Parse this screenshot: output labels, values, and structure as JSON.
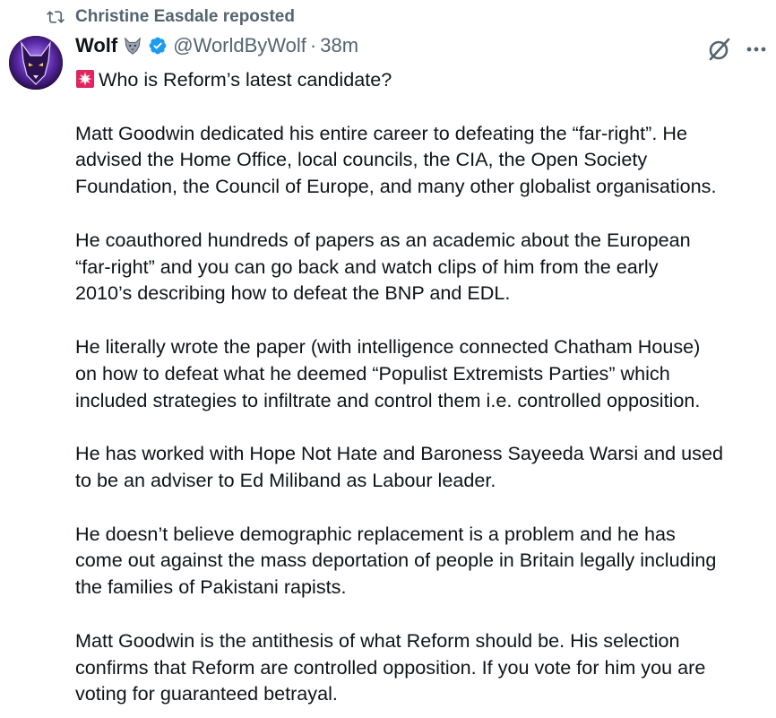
{
  "repost": {
    "icon": "repost-icon",
    "text": "Christine Easdale reposted"
  },
  "author": {
    "name": "Wolf",
    "name_emoji": "wolf-emoji",
    "verified_icon": "verified-badge-icon",
    "handle": "@WorldByWolf",
    "separator": "·",
    "time": "38m",
    "avatar": "wolf-avatar"
  },
  "actions": {
    "grok_icon": "grok-icon",
    "more_icon": "more-icon"
  },
  "tweet": {
    "headline_icon": "siren-emoji",
    "headline": "Who is Reform’s latest candidate?",
    "paragraphs": [
      [
        "Matt Goodwin dedicated his entire career to defeating the “far-right”. He",
        "advised the Home Office, local councils, the CIA, the Open Society",
        "Foundation, the Council of Europe, and many other globalist organisations."
      ],
      [
        "He coauthored hundreds of papers as an academic about the European",
        "“far-right” and you can go back and watch clips of him from the early",
        "2010’s describing how to defeat the BNP and EDL."
      ],
      [
        "He literally wrote the paper (with intelligence connected Chatham House)",
        "on how to defeat what he deemed “Populist Extremists Parties” which",
        "included strategies to infiltrate and control them i.e. controlled opposition."
      ],
      [
        "He has worked with Hope Not Hate and Baroness Sayeeda Warsi and used",
        "to be an adviser to Ed Miliband as Labour leader."
      ],
      [
        "He doesn’t believe demographic replacement is a problem and he has",
        "come out against the mass deportation of people in Britain legally including",
        "the families of Pakistani rapists."
      ],
      [
        "Matt Goodwin is the antithesis of what Reform should be. His selection",
        "confirms that Reform are controlled opposition. If you vote for him you are",
        "voting for guaranteed betrayal."
      ]
    ]
  },
  "colors": {
    "text": "#0f1419",
    "muted": "#536471",
    "verified": "#1d9bf0"
  }
}
